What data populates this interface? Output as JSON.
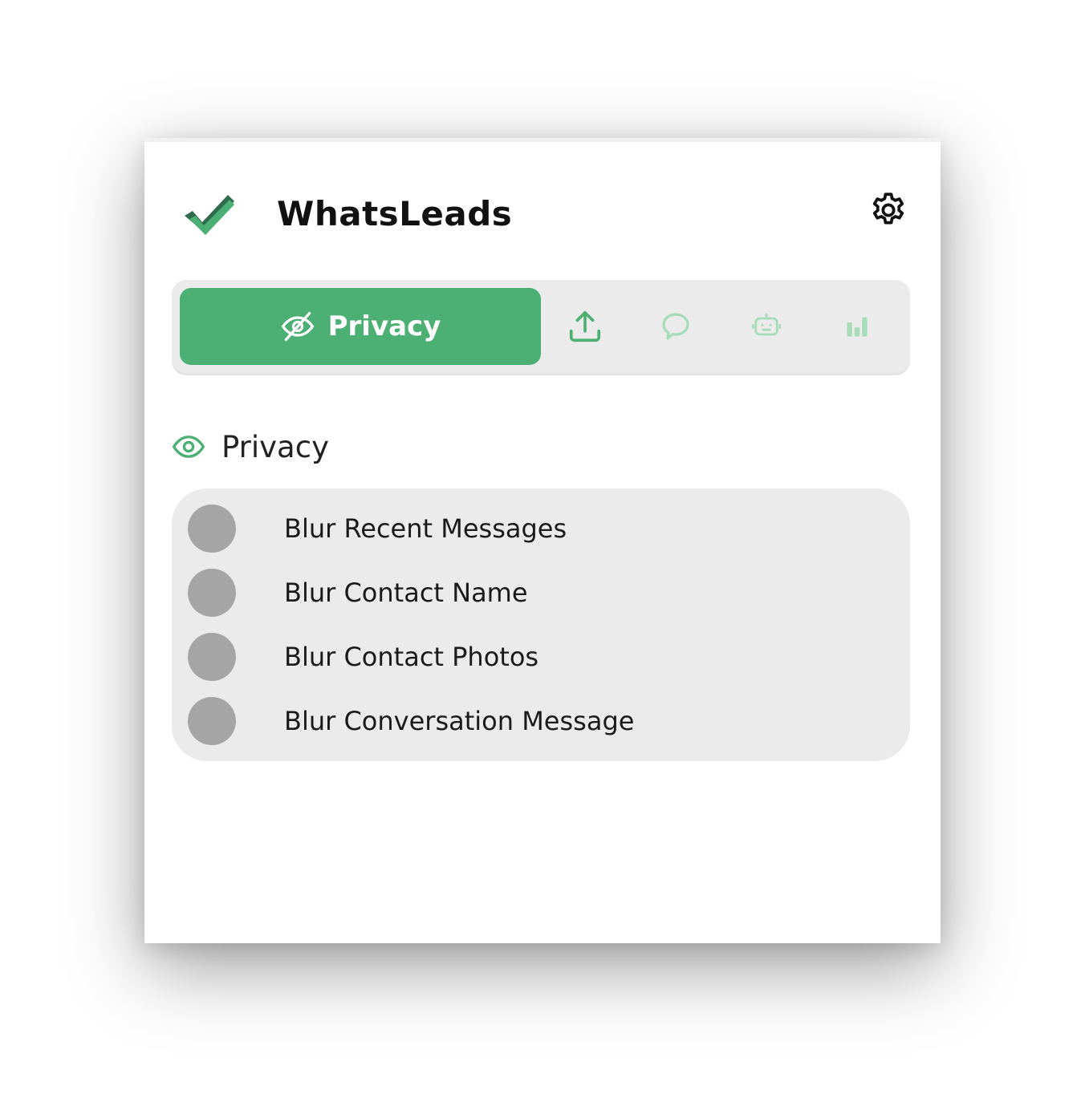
{
  "app": {
    "title": "WhatsLeads"
  },
  "colors": {
    "accent": "#4caf73",
    "accent_light": "#a6dcb8",
    "tabbar_bg": "#ebebeb",
    "toggle_off": "#a5a5a5"
  },
  "tabs": {
    "active": {
      "label": "Privacy",
      "icon": "eye-off-icon"
    },
    "others": [
      {
        "icon": "upload-icon"
      },
      {
        "icon": "chat-bubble-icon"
      },
      {
        "icon": "bot-icon"
      },
      {
        "icon": "bar-chart-icon"
      }
    ]
  },
  "section": {
    "title": "Privacy",
    "icon": "eye-icon"
  },
  "options": [
    {
      "label": "Blur Recent Messages",
      "enabled": false
    },
    {
      "label": "Blur Contact Name",
      "enabled": false
    },
    {
      "label": "Blur Contact Photos",
      "enabled": false
    },
    {
      "label": "Blur Conversation Message",
      "enabled": false
    }
  ]
}
